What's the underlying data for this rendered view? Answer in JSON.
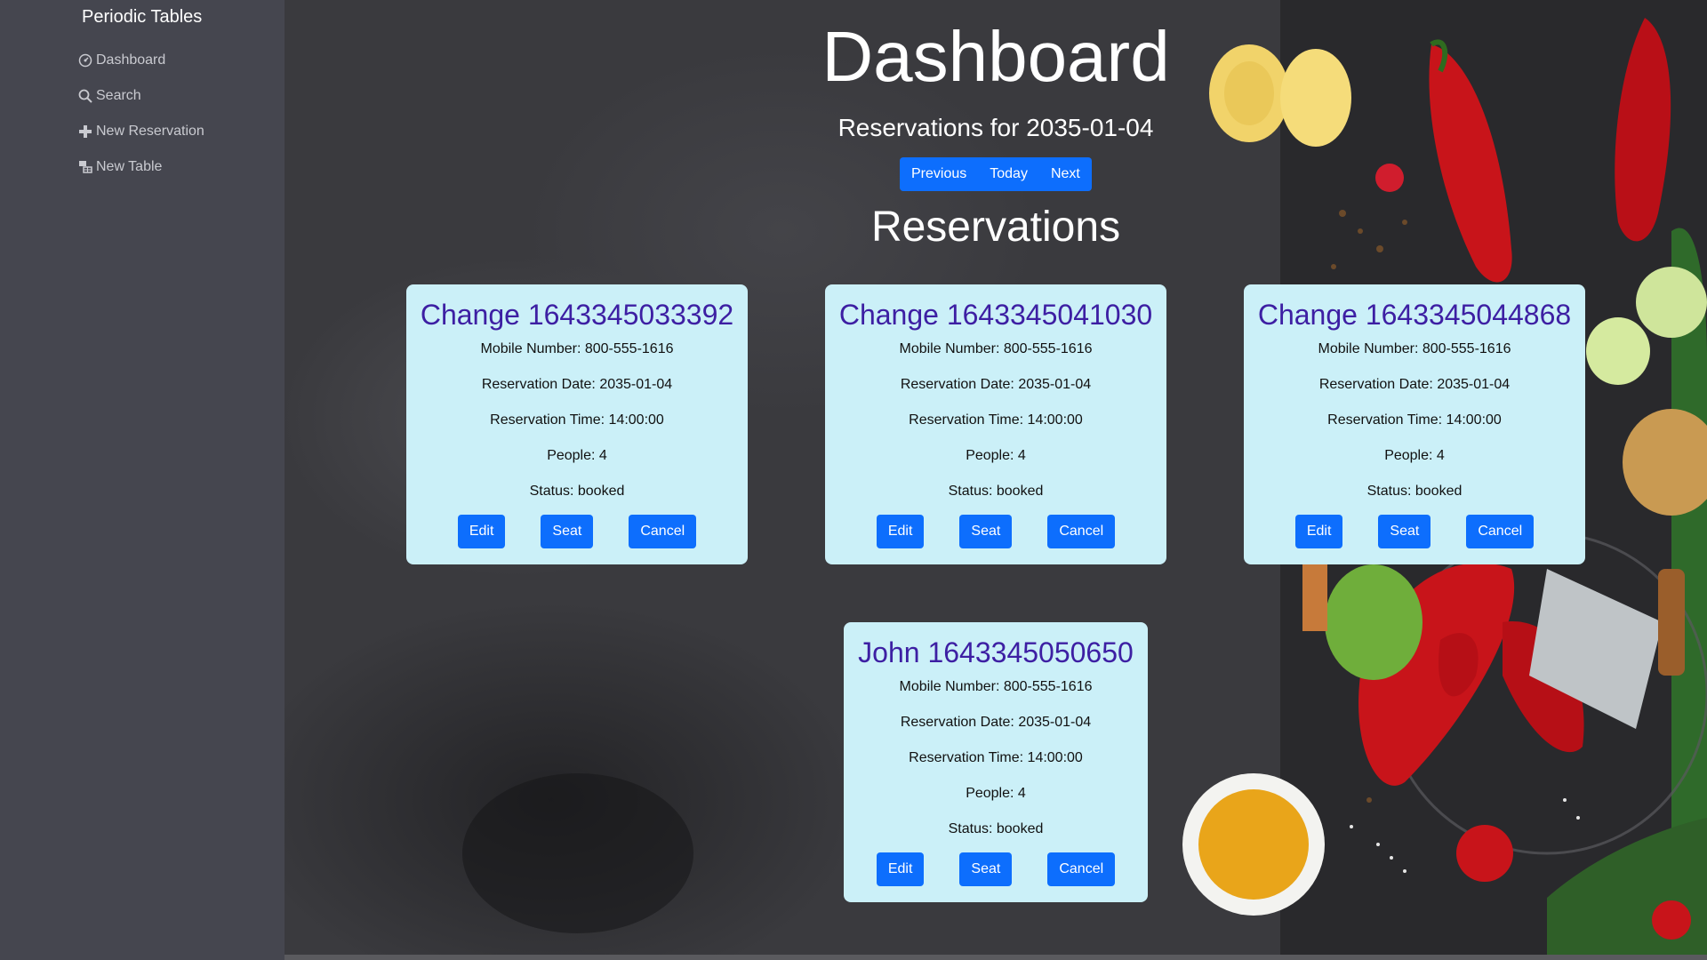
{
  "sidebar": {
    "brand": "Periodic Tables",
    "items": [
      {
        "label": "Dashboard",
        "icon": "dashboard-icon"
      },
      {
        "label": "Search",
        "icon": "search-icon"
      },
      {
        "label": "New Reservation",
        "icon": "plus-icon"
      },
      {
        "label": "New Table",
        "icon": "table-icon"
      }
    ]
  },
  "header": {
    "title": "Dashboard",
    "subtitle": "Reservations for 2035-01-04",
    "nav": {
      "previous": "Previous",
      "today": "Today",
      "next": "Next"
    },
    "section_title": "Reservations"
  },
  "reservations": [
    {
      "name": "Change 1643345033392",
      "mobile": "Mobile Number: 800-555-1616",
      "date": "Reservation Date: 2035-01-04",
      "time": "Reservation Time: 14:00:00",
      "people": "People: 4",
      "status": "Status: booked",
      "edit": "Edit",
      "seat": "Seat",
      "cancel": "Cancel"
    },
    {
      "name": "Change 1643345041030",
      "mobile": "Mobile Number: 800-555-1616",
      "date": "Reservation Date: 2035-01-04",
      "time": "Reservation Time: 14:00:00",
      "people": "People: 4",
      "status": "Status: booked",
      "edit": "Edit",
      "seat": "Seat",
      "cancel": "Cancel"
    },
    {
      "name": "Change 1643345044868",
      "mobile": "Mobile Number: 800-555-1616",
      "date": "Reservation Date: 2035-01-04",
      "time": "Reservation Time: 14:00:00",
      "people": "People: 4",
      "status": "Status: booked",
      "edit": "Edit",
      "seat": "Seat",
      "cancel": "Cancel"
    },
    {
      "name": "John 1643345050650",
      "mobile": "Mobile Number: 800-555-1616",
      "date": "Reservation Date: 2035-01-04",
      "time": "Reservation Time: 14:00:00",
      "people": "People: 4",
      "status": "Status: booked",
      "edit": "Edit",
      "seat": "Seat",
      "cancel": "Cancel"
    }
  ],
  "colors": {
    "sidebar_bg": "#45464f",
    "card_bg": "#cbf0f8",
    "card_title": "#3d1fa3",
    "button_primary": "#0d6efd"
  }
}
